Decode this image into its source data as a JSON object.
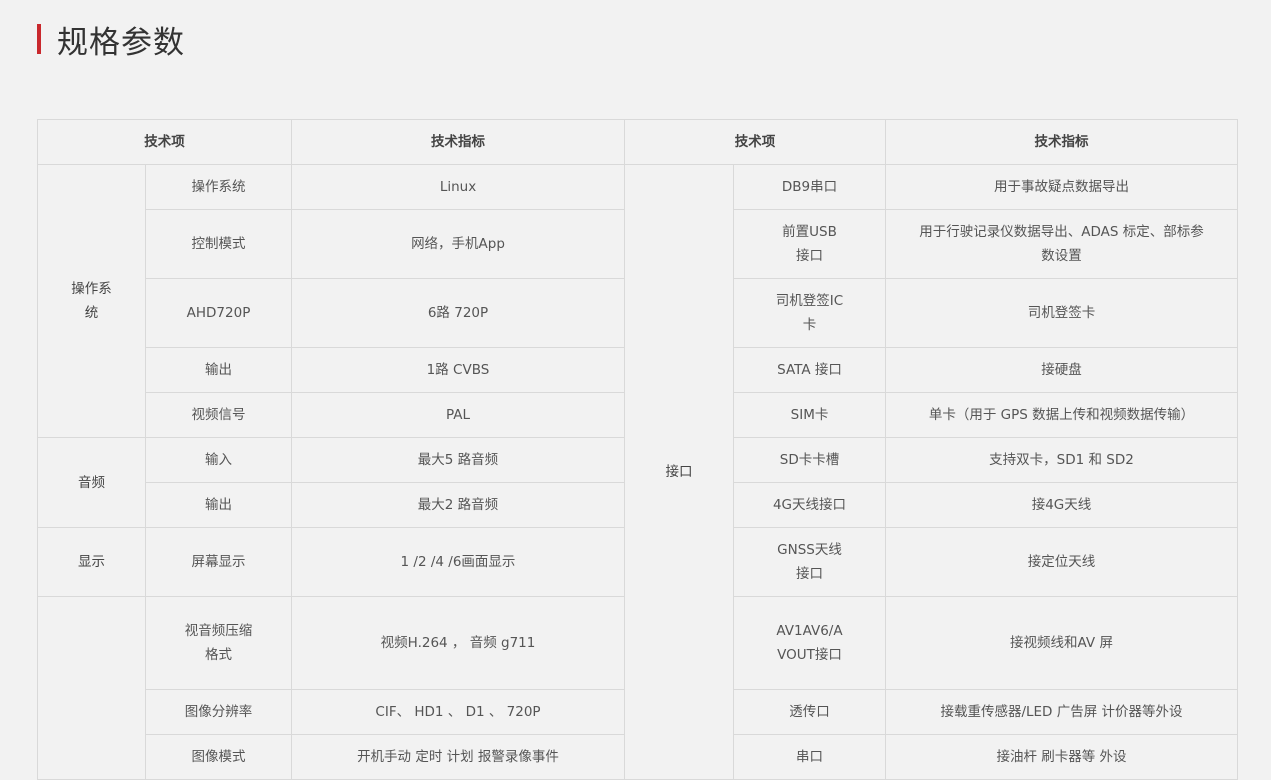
{
  "page": {
    "title": "规格参数"
  },
  "table": {
    "header": {
      "item_left": "技术项",
      "spec_left": "技术指标",
      "item_right": "技术项",
      "spec_right": "技术指标"
    },
    "groups": {
      "os": "操作系统",
      "audio": "音频",
      "display": "显示",
      "interface": "接口"
    },
    "left": [
      {
        "item": "操作系统",
        "spec": "Linux"
      },
      {
        "item": "控制模式",
        "spec": "网络，手机App"
      },
      {
        "item": "AHD720P",
        "spec": "6路 720P"
      },
      {
        "item": "输出",
        "spec": "1路 CVBS"
      },
      {
        "item": "视频信号",
        "spec": "PAL"
      },
      {
        "item": "输入",
        "spec": "最大5 路音频"
      },
      {
        "item": "输出",
        "spec": "最大2 路音频"
      },
      {
        "item": "屏幕显示",
        "spec": "1 /2 /4 /6画面显示"
      },
      {
        "item": "视音频压缩格式",
        "spec": "视频H.264 ， 音频 g711"
      },
      {
        "item": "图像分辨率",
        "spec": "CIF、 HD1 、 D1 、 720P"
      },
      {
        "item": "图像模式",
        "spec": "开机手动 定时 计划 报警录像事件"
      }
    ],
    "right": [
      {
        "item": "DB9串口",
        "spec": "用于事故疑点数据导出"
      },
      {
        "item": "前置USB 接口",
        "spec": "用于行驶记录仪数据导出、ADAS 标定、部标参数设置"
      },
      {
        "item": "司机登签IC卡",
        "spec": "司机登签卡"
      },
      {
        "item": "SATA 接口",
        "spec": "接硬盘"
      },
      {
        "item": "SIM卡",
        "spec": "单卡（用于 GPS 数据上传和视频数据传输）"
      },
      {
        "item": "SD卡卡槽",
        "spec": "支持双卡，SD1 和 SD2"
      },
      {
        "item": "4G天线接口",
        "spec": "接4G天线"
      },
      {
        "item": "GNSS天线接口",
        "spec": "接定位天线"
      },
      {
        "item": "AV1AV6/AVOUT接口",
        "spec": "接视频线和AV 屏"
      },
      {
        "item": "透传口",
        "spec": "接载重传感器/LED 广告屏 计价器等外设"
      },
      {
        "item": "串口",
        "spec": "接油杆 刷卡器等 外设"
      }
    ]
  }
}
